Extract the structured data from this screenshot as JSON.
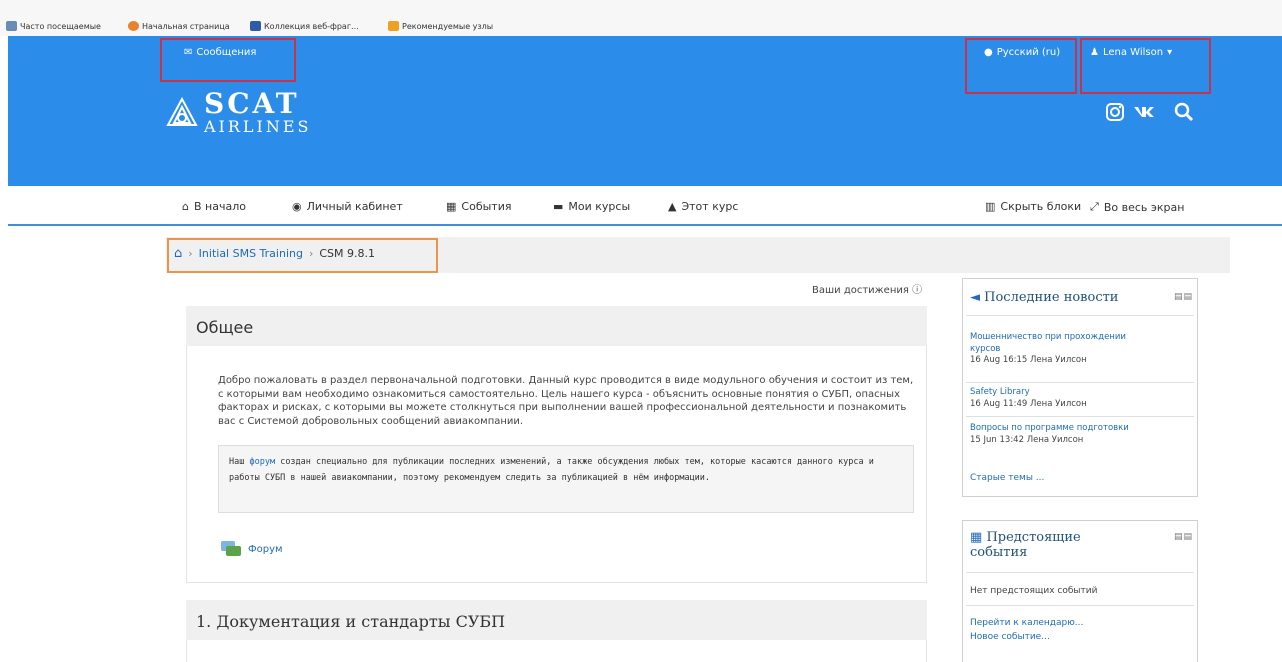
{
  "browser": {
    "bookmarks": [
      {
        "label": "Часто посещаемые",
        "icon": "bookmarks-icon"
      },
      {
        "label": "Начальная страница",
        "icon": "firefox-icon"
      },
      {
        "label": "Коллекция веб-фраг...",
        "icon": "webslice-icon"
      },
      {
        "label": "Рекомендуемые узлы",
        "icon": "suggested-sites-icon"
      }
    ]
  },
  "header": {
    "messages_label": "Сообщения",
    "language_label": "Русский (ru)",
    "user_label": "Lena Wilson",
    "logo_line1": "SCAT",
    "logo_line2": "AIRLINES",
    "social": [
      "instagram-icon",
      "vk-icon",
      "search-icon"
    ],
    "color": "#2b8cea"
  },
  "nav": {
    "items": [
      {
        "label": "В начало",
        "icon": "home-icon"
      },
      {
        "label": "Личный кабинет",
        "icon": "dashboard-icon"
      },
      {
        "label": "События",
        "icon": "calendar-icon"
      },
      {
        "label": "Мои курсы",
        "icon": "courses-icon"
      },
      {
        "label": "Этот курс",
        "icon": "sitemap-icon"
      }
    ],
    "hide_blocks_label": "Скрыть блоки",
    "fullscreen_label": "Во весь экран"
  },
  "breadcrumb": {
    "items": [
      "Initial SMS Training",
      "CSM 9.8.1"
    ]
  },
  "achievements_label": "Ваши достижения",
  "general": {
    "title": "Общее",
    "intro": "Добро пожаловать в раздел первоначальной подготовки. Данный курс проводится в виде модульного обучения и состоит из тем, с которыми вам необходимо ознакомиться самостоятельно. Цель нашего курса - объяснить основные понятия о СУБП, опасных факторах и рисках, с которыми вы можете столкнуться при выполнении вашей профессиональной деятельности и познакомить вас с Системой добровольных сообщений авиакомпании.",
    "quote_before": "Наш ",
    "quote_link": "форум",
    "quote_after": " создан специально для публикации последних изменений, а также обсуждения любых тем, которые касаются данного курса и работы СУБП в нашей авиакомпании, поэтому рекомендуем следить за публикацией в нём информации.",
    "forum_label": "Форум"
  },
  "section1": {
    "title": "1. Документация и стандарты СУБП"
  },
  "news_block": {
    "title": "Последние новости",
    "items": [
      {
        "title_line1": "Мошенничество при прохождении",
        "title_line2": "курсов",
        "date": "16 Aug 16:15",
        "author": "Лена Уилсон"
      },
      {
        "title_line1": "Safety Library",
        "title_line2": "",
        "date": "16 Aug 11:49",
        "author": "Лена Уилсон"
      },
      {
        "title_line1": "Вопросы по программе подготовки",
        "title_line2": "",
        "date": "15 Jun 13:42",
        "author": "Лена Уилсон"
      }
    ],
    "older_label": "Старые темы ..."
  },
  "events_block": {
    "title_line1": "Предстоящие",
    "title_line2": "события",
    "empty_label": "Нет предстоящих событий",
    "calendar_link": "Перейти к календарю...",
    "new_event_link": "Новое событие..."
  }
}
